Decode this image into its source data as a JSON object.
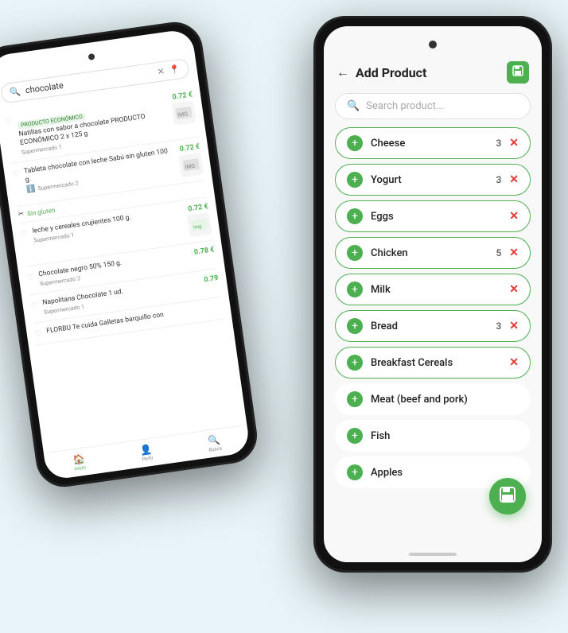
{
  "left_phone": {
    "search_text": "chocolate",
    "products": [
      {
        "badge": "PRODUCTO ECONÓMICO",
        "name": "Natillas con sabor a chocolate PRODUCTO ECONÓMICO 2 x 125 g",
        "store": "Supermercado 1",
        "price": "0.72 €"
      },
      {
        "name": "Tableta chocolate con leche Sabú sin gluten 100 g.",
        "store": "Supermercado 2",
        "price": "0.72 €"
      },
      {
        "name": "leche y cereales crujientes 100 g.",
        "store": "Supermercado 1",
        "price": "0.72 €"
      },
      {
        "name": "Chocolate negro 50% 150 g.",
        "store": "Supermercado 2",
        "price": "0.78 €"
      },
      {
        "name": "Napolitana Chocolate 1 ud.",
        "store": "Supermercado 1",
        "price": "0.79"
      },
      {
        "name": "FLORBU Te cuida Galletas barquillo con",
        "store": "",
        "price": ""
      }
    ],
    "alert_text": "Sin gluten",
    "nav_items": [
      {
        "label": "Inicio",
        "icon": "🏠",
        "active": true
      },
      {
        "label": "Perfil",
        "icon": "👤",
        "active": false
      },
      {
        "label": "Busca",
        "icon": "🔍",
        "active": false
      }
    ]
  },
  "right_phone": {
    "header_title": "Add Product",
    "search_placeholder": "Search product...",
    "products": [
      {
        "name": "Cheese",
        "qty": 3,
        "has_x": true,
        "bordered": true
      },
      {
        "name": "Yogurt",
        "qty": 3,
        "has_x": true,
        "bordered": true
      },
      {
        "name": "Eggs",
        "qty": null,
        "has_x": true,
        "bordered": true
      },
      {
        "name": "Chicken",
        "qty": 5,
        "has_x": true,
        "bordered": true
      },
      {
        "name": "Milk",
        "qty": null,
        "has_x": true,
        "bordered": true
      },
      {
        "name": "Bread",
        "qty": 3,
        "has_x": true,
        "bordered": true
      },
      {
        "name": "Breakfast Cereals",
        "qty": null,
        "has_x": true,
        "bordered": true
      },
      {
        "name": "Meat (beef and pork)",
        "qty": null,
        "has_x": false,
        "bordered": false
      },
      {
        "name": "Fish",
        "qty": null,
        "has_x": false,
        "bordered": false
      },
      {
        "name": "Apples",
        "qty": null,
        "has_x": false,
        "bordered": false
      }
    ],
    "back_label": "←",
    "save_icon": "💾",
    "fab_icon": "💾"
  }
}
